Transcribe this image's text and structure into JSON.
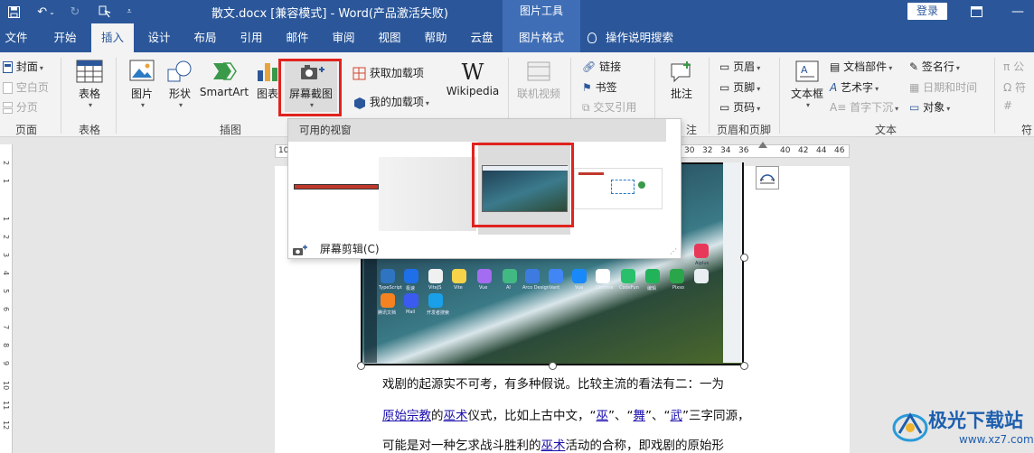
{
  "window": {
    "title": "散文.docx [兼容模式] - Word(产品激活失败)",
    "context_group": "图片工具",
    "login": "登录"
  },
  "tabs": [
    "文件",
    "开始",
    "插入",
    "设计",
    "布局",
    "引用",
    "邮件",
    "审阅",
    "视图",
    "帮助",
    "云盘",
    "图片格式"
  ],
  "active_tab": "插入",
  "tell_me": "操作说明搜索",
  "ribbon": {
    "pages": {
      "cover": "封面",
      "blank": "空白页",
      "break": "分页",
      "label": "页面"
    },
    "tables": {
      "table": "表格",
      "label": "表格"
    },
    "illustrations": {
      "picture": "图片",
      "shapes": "形状",
      "smartart": "SmartArt",
      "chart": "图表",
      "screenshot": "屏幕截图",
      "label": "插图"
    },
    "addins": {
      "get": "获取加载项",
      "mine": "我的加载项",
      "wikipedia": "Wikipedia"
    },
    "media": {
      "online_video": "联机视频"
    },
    "links": {
      "link": "链接",
      "bookmark": "书签",
      "crossref": "交叉引用"
    },
    "comments": {
      "comment": "批注",
      "label_partial": "注"
    },
    "header_footer": {
      "header": "页眉",
      "footer": "页脚",
      "page_number": "页码",
      "label": "页眉和页脚"
    },
    "text": {
      "textbox": "文本框",
      "parts": "文档部件",
      "wordart": "艺术字",
      "dropcap": "首字下沉",
      "signature": "签名行",
      "datetime": "日期和时间",
      "object": "对象",
      "label": "文本"
    },
    "symbols": {
      "equation": "公",
      "symbol": "符",
      "label_partial": "符"
    }
  },
  "screenshot_dropdown": {
    "header": "可用的视窗",
    "screen_clipping": "屏幕剪辑(C)"
  },
  "ruler": {
    "numbers_left": [
      "10"
    ],
    "numbers_right": [
      "30",
      "32",
      "34",
      "36",
      "40",
      "42",
      "44",
      "46",
      "48"
    ],
    "vertical": [
      "2",
      "1",
      "1",
      "2",
      "3",
      "4",
      "5",
      "6",
      "7",
      "8",
      "9",
      "10",
      "11",
      "12",
      "13",
      "14",
      "15",
      "16",
      "17"
    ]
  },
  "embedded_image": {
    "apps_row1": [
      "TypeScript",
      "极速",
      "ViteJS",
      "Vite",
      "Vue",
      "AI",
      "Arco Design",
      "Vant",
      "Vue",
      "Chrome",
      "CodeFun",
      "编辑",
      "Pixso"
    ],
    "apps_row2": [
      "腾讯文档",
      "Mail",
      "开发者搜索"
    ],
    "side_label": "Aiplus"
  },
  "document": {
    "para1": "戏剧的起源实不可考，有多种假说。比较主流的看法有二：一为",
    "para2_parts": [
      "原始宗教",
      "的",
      "巫术",
      "仪式，比如上古中文，“",
      "巫",
      "”、“",
      "舞",
      "”、“",
      "武",
      "”三字同源，"
    ],
    "para3_parts": [
      "可能是对一种乞求战斗胜利的",
      "巫术",
      "活动的合称，即戏剧的原始形"
    ]
  },
  "watermark": {
    "text": "极光下载站",
    "url": "www.xz7.com"
  },
  "colors": {
    "brand": "#2b579a",
    "highlight": "#e0231f",
    "link": "#1a0dab"
  }
}
